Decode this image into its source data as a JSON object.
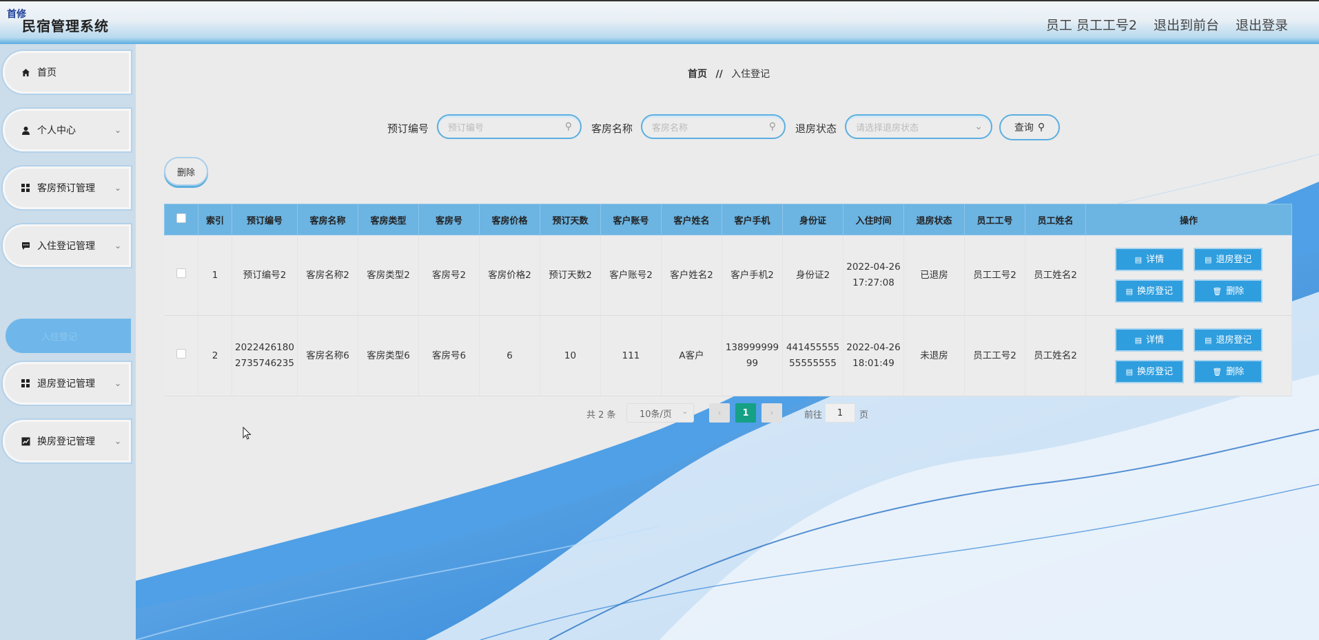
{
  "header": {
    "badge": "首修",
    "title": "民宿管理系统",
    "user": "员工 员工工号2",
    "to_front": "退出到前台",
    "logout": "退出登录"
  },
  "sidebar": {
    "items": [
      {
        "label": "首页",
        "icon": "home-icon"
      },
      {
        "label": "个人中心",
        "icon": "user-icon"
      },
      {
        "label": "客房预订管理",
        "icon": "grid-icon"
      },
      {
        "label": "入住登记管理",
        "icon": "chat-icon"
      },
      {
        "label": "退房登记管理",
        "icon": "grid-icon"
      },
      {
        "label": "换房登记管理",
        "icon": "chart-icon"
      }
    ],
    "active_sub": "入住登记"
  },
  "breadcrumb": {
    "home": "首页",
    "sep": "//",
    "current": "入住登记"
  },
  "search": {
    "order_label": "预订编号",
    "order_placeholder": "预订编号",
    "room_label": "客房名称",
    "room_placeholder": "客房名称",
    "status_label": "退房状态",
    "status_placeholder": "请选择退房状态",
    "query_label": "查询"
  },
  "actions": {
    "delete": "删除"
  },
  "table": {
    "headers": [
      "索引",
      "预订编号",
      "客房名称",
      "客房类型",
      "客房号",
      "客房价格",
      "预订天数",
      "客户账号",
      "客户姓名",
      "客户手机",
      "身份证",
      "入住时间",
      "退房状态",
      "员工工号",
      "员工姓名",
      "操作"
    ],
    "rows": [
      {
        "index": "1",
        "order": "预订编号2",
        "room_name": "客房名称2",
        "room_type": "客房类型2",
        "room_no": "客房号2",
        "price": "客房价格2",
        "days": "预订天数2",
        "account": "客户账号2",
        "name": "客户姓名2",
        "phone": "客户手机2",
        "id_card": "身份证2",
        "checkin": "2022-04-26 17:27:08",
        "status": "已退房",
        "staff_no": "员工工号2",
        "staff_name": "员工姓名2"
      },
      {
        "index": "2",
        "order": "20224261802735746235",
        "room_name": "客房名称6",
        "room_type": "客房类型6",
        "room_no": "客房号6",
        "price": "6",
        "days": "10",
        "account": "111",
        "name": "A客户",
        "phone": "13899999999",
        "id_card": "44145555555555555",
        "checkin": "2022-04-26 18:01:49",
        "status": "未退房",
        "staff_no": "员工工号2",
        "staff_name": "员工姓名2"
      }
    ],
    "ops": {
      "detail": "详情",
      "checkout": "退房登记",
      "change": "换房登记",
      "delete": "删除"
    }
  },
  "pager": {
    "total": "共 2 条",
    "size": "10条/页",
    "current": "1",
    "goto": "前往",
    "goto_value": "1",
    "page_unit": "页"
  },
  "colors": {
    "accent": "#5aaee0",
    "header_th": "#6cb4e2",
    "op_button": "#2f9ede",
    "page_active": "#16a085"
  }
}
